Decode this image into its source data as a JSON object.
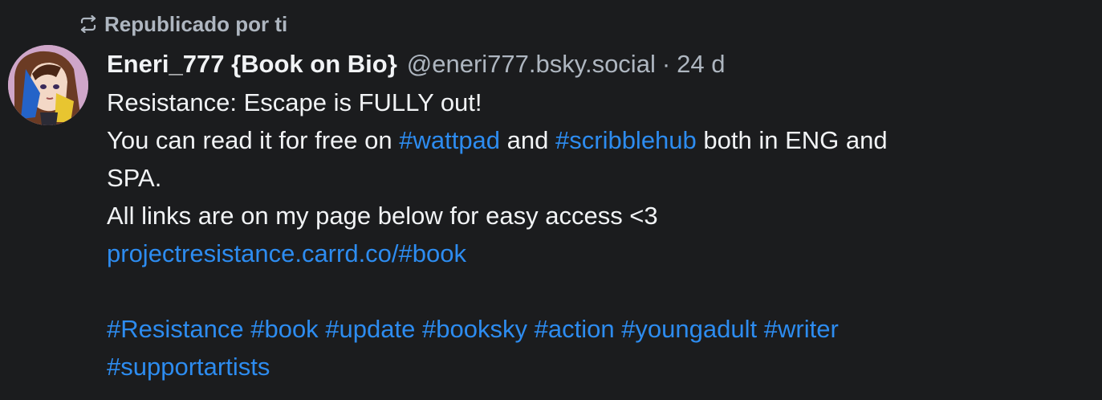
{
  "repost": {
    "label": "Republicado por ti",
    "icon": "repost-icon"
  },
  "author": {
    "display_name": "Eneri_777 {Book on Bio}",
    "handle": "@eneri777.bsky.social",
    "separator": "·",
    "time": "24 d"
  },
  "post": {
    "line1": "Resistance: Escape is FULLY out!",
    "line2_before": "You can read it for free on ",
    "tag_wattpad": "#wattpad",
    "line2_mid": " and ",
    "tag_scribblehub": "#scribblehub",
    "line2_after": " both in ENG and",
    "line3": "SPA.",
    "line4": "All links are on my page below for easy access <3",
    "link": "projectresistance.carrd.co/#book",
    "hashtags": [
      "#Resistance",
      "#book",
      "#update",
      "#booksky",
      "#action",
      "#youngadult",
      "#writer",
      "#supportartists"
    ]
  },
  "colors": {
    "background": "#1b1c1e",
    "text": "#f1f3f5",
    "muted": "#aeb6c0",
    "link": "#2d8cf0"
  }
}
